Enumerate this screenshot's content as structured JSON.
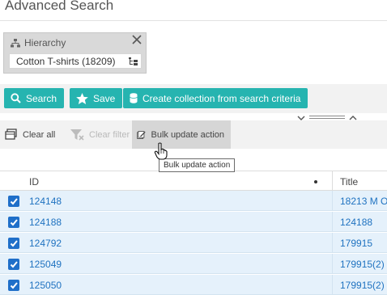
{
  "page": {
    "title": "Advanced Search"
  },
  "filter": {
    "label": "Hierarchy",
    "value": "Cotton T-shirts (18209)"
  },
  "actions": {
    "search_label": "Search",
    "save_label": "Save",
    "create_collection_label": "Create collection from search criteria"
  },
  "toolbar": {
    "clear_all_label": "Clear all",
    "clear_filter_label": "Clear filter",
    "bulk_update_label": "Bulk update action",
    "tooltip": "Bulk update action"
  },
  "grid": {
    "columns": [
      "ID",
      "Title"
    ],
    "rows": [
      {
        "id": "124148",
        "title": "18213 M O",
        "checked": true
      },
      {
        "id": "124188",
        "title": "124188",
        "checked": true
      },
      {
        "id": "124792",
        "title": "179915",
        "checked": true
      },
      {
        "id": "125049",
        "title": "179915(2)",
        "checked": true
      },
      {
        "id": "125050",
        "title": "179915(2)",
        "checked": true
      }
    ]
  },
  "colors": {
    "accent": "#26b4b0",
    "row_selected": "#e5f1fb",
    "checkbox": "#1f6fc9",
    "link": "#1f72c0"
  }
}
